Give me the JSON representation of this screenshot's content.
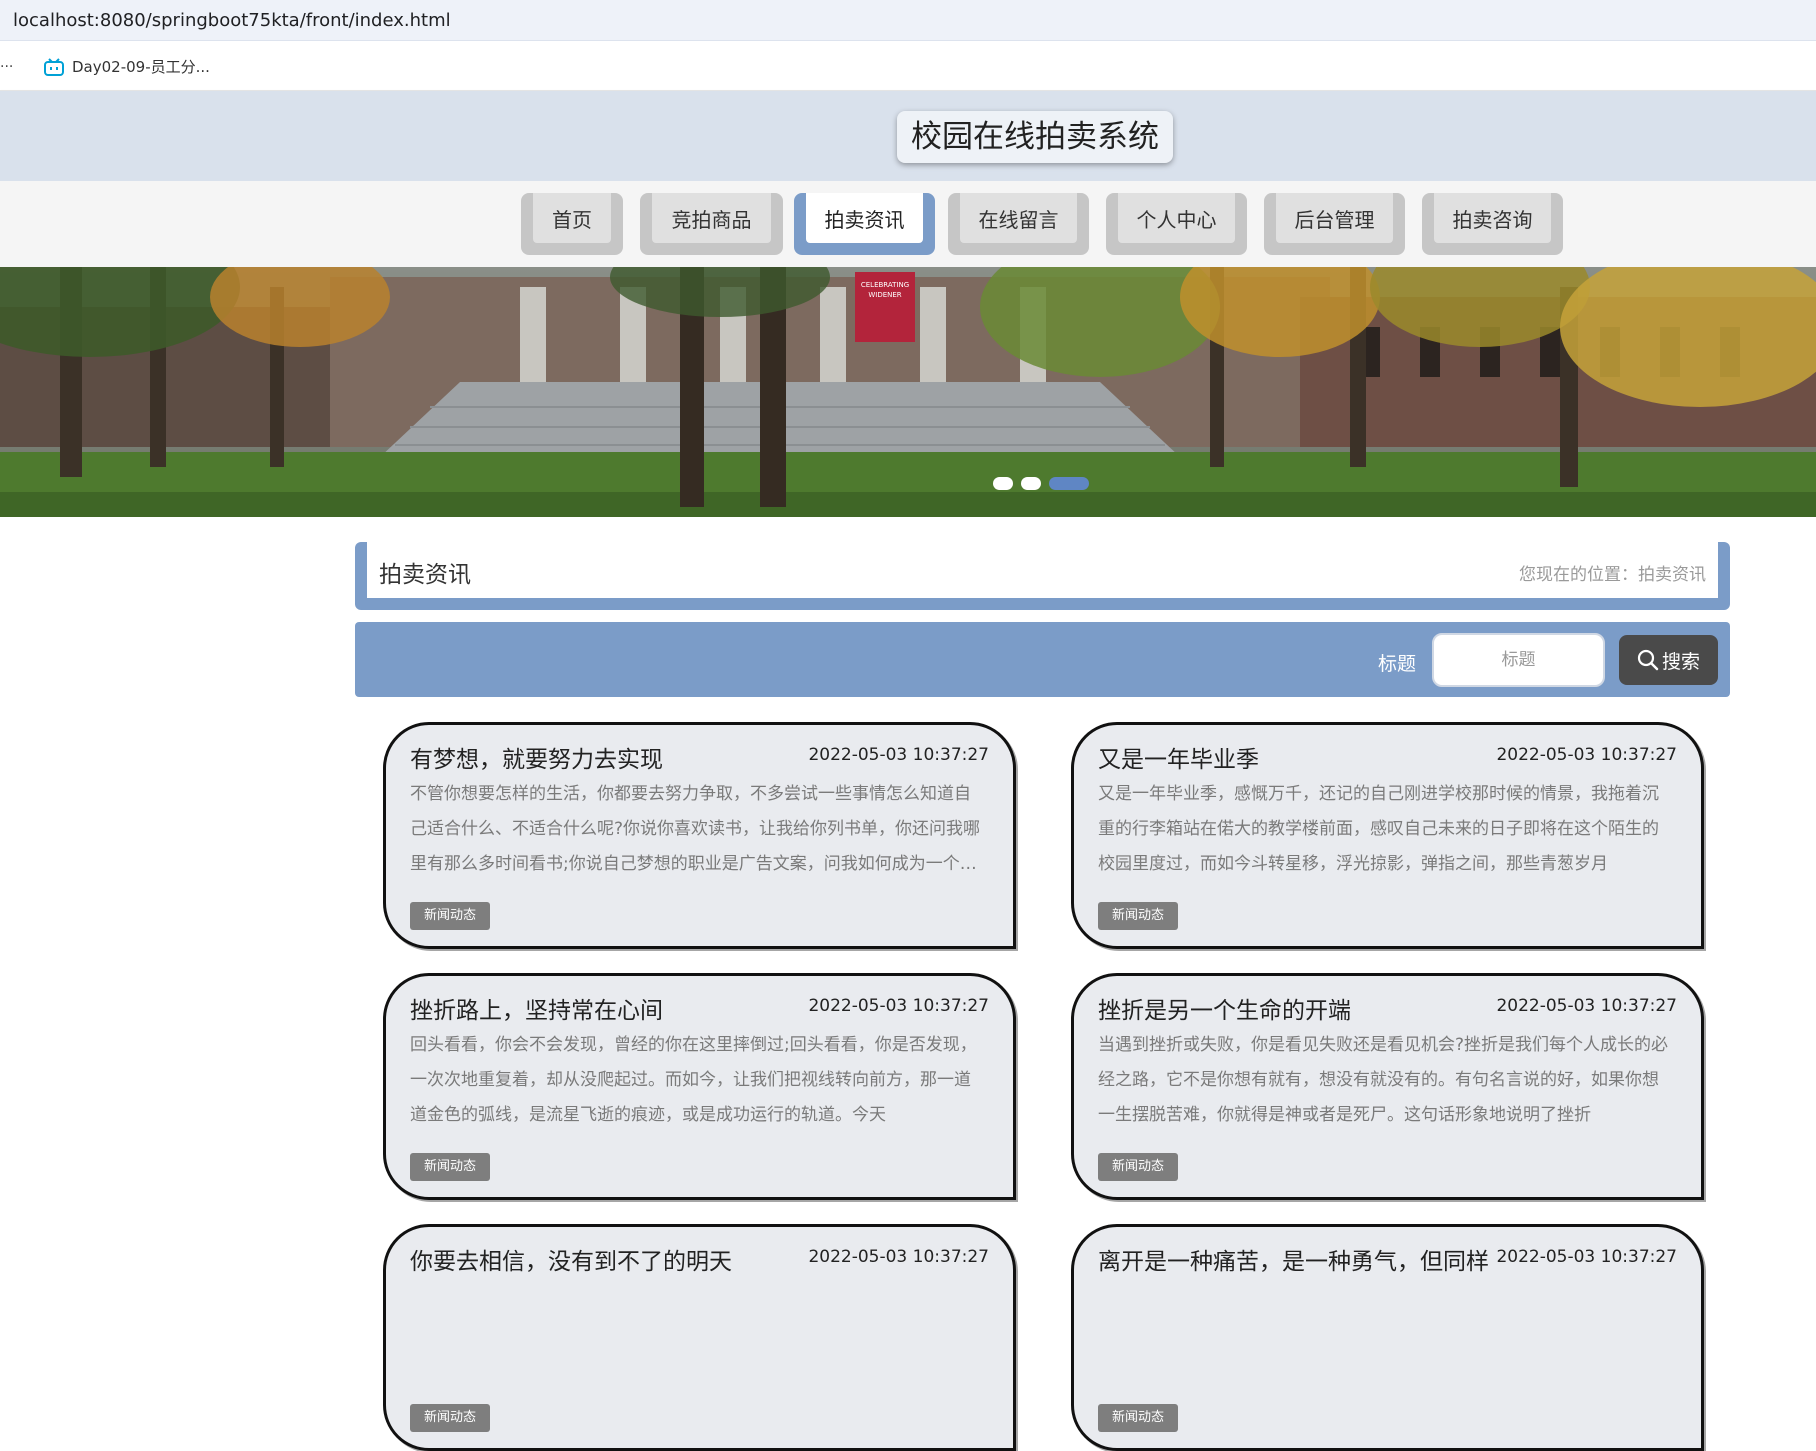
{
  "browser": {
    "url": "localhost:8080/springboot75kta/front/index.html",
    "bookmarks_overflow": "...",
    "bookmark": {
      "label": "Day02-09-员工分..."
    }
  },
  "site": {
    "title": "校园在线拍卖系统"
  },
  "nav": {
    "items": [
      {
        "label": "首页",
        "active": false
      },
      {
        "label": "竞拍商品",
        "active": false
      },
      {
        "label": "拍卖资讯",
        "active": true
      },
      {
        "label": "在线留言",
        "active": false
      },
      {
        "label": "个人中心",
        "active": false
      },
      {
        "label": "后台管理",
        "active": false
      },
      {
        "label": "拍卖咨询",
        "active": false
      }
    ]
  },
  "banner": {
    "slide_count": 3,
    "active_slide": 3,
    "sign_text": "CELEBRATING WIDENER"
  },
  "page": {
    "heading": "拍卖资讯",
    "breadcrumb": "您现在的位置：拍卖资讯"
  },
  "search": {
    "label": "标题",
    "placeholder": "标题",
    "value": "",
    "button_label": "搜索"
  },
  "articles": [
    {
      "title": "有梦想，就要努力去实现",
      "time": "2022-05-03 10:37:27",
      "summary": "不管你想要怎样的生活，你都要去努力争取，不多尝试一些事情怎么知道自己适合什么、不适合什么呢?你说你喜欢读书，让我给你列书单，你还问我哪里有那么多时间看书;你说自己梦想的职业是广告文案，问我如何成为一个好的广告文案",
      "tag": "新闻动态"
    },
    {
      "title": "又是一年毕业季",
      "time": "2022-05-03 10:37:27",
      "summary": "又是一年毕业季，感慨万千，还记的自己刚进学校那时候的情景，我拖着沉重的行李箱站在偌大的教学楼前面，感叹自己未来的日子即将在这个陌生的校园里度过，而如今斗转星移，浮光掠影，弹指之间，那些青葱岁月",
      "tag": "新闻动态"
    },
    {
      "title": "挫折路上，坚持常在心间",
      "time": "2022-05-03 10:37:27",
      "summary": "回头看看，你会不会发现，曾经的你在这里摔倒过;回头看看，你是否发现，一次次地重复着，却从没爬起过。而如今，让我们把视线转向前方，那一道道金色的弧线，是流星飞逝的痕迹，或是成功运行的轨道。今天",
      "tag": "新闻动态"
    },
    {
      "title": "挫折是另一个生命的开端",
      "time": "2022-05-03 10:37:27",
      "summary": "当遇到挫折或失败，你是看见失败还是看见机会?挫折是我们每个人成长的必经之路，它不是你想有就有，想没有就没有的。有句名言说的好，如果你想一生摆脱苦难，你就得是神或者是死尸。这句话形象地说明了挫折",
      "tag": "新闻动态"
    },
    {
      "title": "你要去相信，没有到不了的明天",
      "time": "2022-05-03 10:37:27",
      "summary": "",
      "tag": "新闻动态"
    },
    {
      "title": "离开是一种痛苦，是一种勇气，但同样",
      "time": "2022-05-03 10:37:27",
      "summary": "",
      "tag": "新闻动态"
    }
  ],
  "colors": {
    "accent": "#7b9cc8",
    "header_bg": "#d9e1ec",
    "card_bg": "#e9ebef",
    "tag_bg": "#7e7e7e",
    "search_button": "#4a4a4a"
  }
}
